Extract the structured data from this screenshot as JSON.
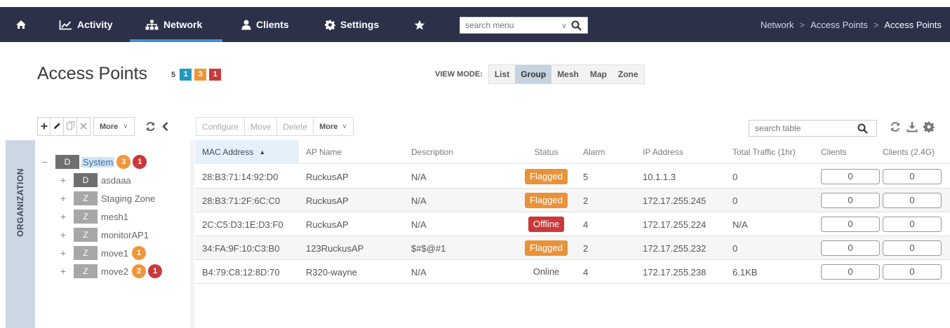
{
  "nav": {
    "items": [
      {
        "label": "Activity",
        "icon": "chart-line-icon"
      },
      {
        "label": "Network",
        "icon": "sitemap-icon"
      },
      {
        "label": "Clients",
        "icon": "user-icon"
      },
      {
        "label": "Settings",
        "icon": "gear-icon"
      }
    ],
    "active": "Network",
    "search_placeholder": "search menu",
    "breadcrumb": [
      "Network",
      "Access Points",
      "Access Points"
    ]
  },
  "page": {
    "title": "Access Points",
    "counts": {
      "total": "5",
      "online": "1",
      "flagged": "3",
      "offline": "1"
    },
    "view_mode_label": "VIEW MODE:",
    "view_modes": [
      "List",
      "Group",
      "Mesh",
      "Map",
      "Zone"
    ],
    "active_view_mode": "Group"
  },
  "tree_toolbar": {
    "more_label": "More"
  },
  "table_toolbar": {
    "configure_label": "Configure",
    "move_label": "Move",
    "delete_label": "Delete",
    "more_label": "More",
    "search_placeholder": "search table"
  },
  "organization": {
    "tab_label": "ORGANIZATION",
    "nodes": [
      {
        "toggle": "−",
        "type": "D",
        "label": "System",
        "flagged": "3",
        "offline": "1"
      },
      {
        "toggle": "+",
        "type": "D",
        "label": "asdaaa"
      },
      {
        "toggle": "+",
        "type": "Z",
        "label": "Staging Zone"
      },
      {
        "toggle": "+",
        "type": "Z",
        "label": "mesh1"
      },
      {
        "toggle": "+",
        "type": "Z",
        "label": "monitorAP1"
      },
      {
        "toggle": "+",
        "type": "Z",
        "label": "move1",
        "flagged": "1"
      },
      {
        "toggle": "+",
        "type": "Z",
        "label": "move2",
        "flagged": "2",
        "offline": "1"
      }
    ]
  },
  "table": {
    "columns": [
      "MAC Address",
      "AP Name",
      "Description",
      "Status",
      "Alarm",
      "IP Address",
      "Total Traffic (1hr)",
      "Clients",
      "Clients (2.4G)"
    ],
    "sort_indicator": "▲",
    "rows": [
      {
        "mac": "28:B3:71:14:92:D0",
        "name": "RuckusAP",
        "desc": "N/A",
        "status": "Flagged",
        "alarm": "5",
        "ip": "10.1.1.3",
        "traffic": "0",
        "clients": "0",
        "clients24": "0"
      },
      {
        "mac": "28:B3:71:2F:6C:C0",
        "name": "RuckusAP",
        "desc": "N/A",
        "status": "Flagged",
        "alarm": "2",
        "ip": "172.17.255.245",
        "traffic": "0",
        "clients": "0",
        "clients24": "0"
      },
      {
        "mac": "2C:C5:D3:1E:D3:F0",
        "name": "RuckusAP",
        "desc": "N/A",
        "status": "Offline",
        "alarm": "4",
        "ip": "172.17.255.224",
        "traffic": "N/A",
        "clients": "0",
        "clients24": "0"
      },
      {
        "mac": "34:FA:9F:10:C3:B0",
        "name": "123RuckusAP",
        "desc": "$#$@#1",
        "status": "Flagged",
        "alarm": "2",
        "ip": "172.17.255.232",
        "traffic": "0",
        "clients": "0",
        "clients24": "0"
      },
      {
        "mac": "B4:79:C8:12:8D:70",
        "name": "R320-wayne",
        "desc": "N/A",
        "status": "Online",
        "alarm": "4",
        "ip": "172.17.255.238",
        "traffic": "6.1KB",
        "clients": "0",
        "clients24": "0"
      }
    ]
  },
  "colors": {
    "nav_bg": "#2c3048",
    "nav_active": "#3d8fd4",
    "flagged": "#e8923a",
    "offline": "#c9383a",
    "online": "#2596be",
    "org_tab": "#cdd7e4"
  }
}
